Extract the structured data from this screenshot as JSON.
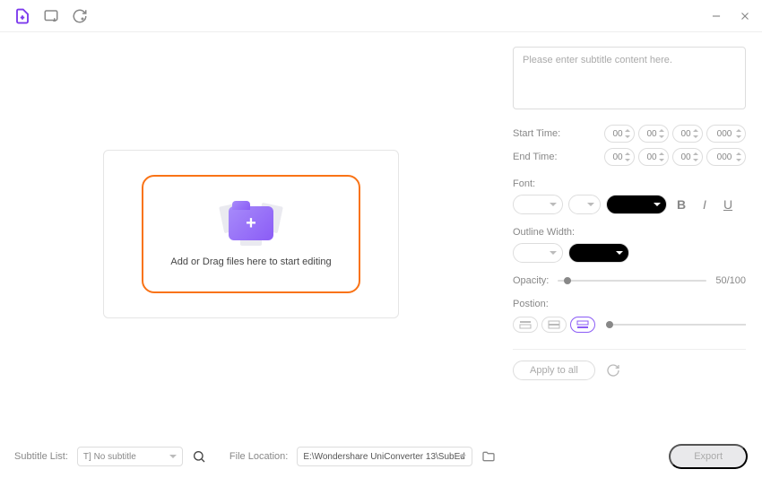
{
  "subtitle": {
    "placeholder": "Please enter subtitle content here.",
    "start_label": "Start Time:",
    "end_label": "End Time:",
    "time_hh": "00",
    "time_mm": "00",
    "time_ss": "00",
    "time_ms": "000"
  },
  "font": {
    "label": "Font:"
  },
  "outline": {
    "label": "Outline Width:"
  },
  "opacity": {
    "label": "Opacity:",
    "value": "50/100"
  },
  "position": {
    "label": "Postion:"
  },
  "apply": {
    "label": "Apply to all"
  },
  "drop": {
    "text": "Add or Drag files here to start editing"
  },
  "footer": {
    "subtitle_list_label": "Subtitle List:",
    "subtitle_select": "T] No subtitle",
    "file_location_label": "File Location:",
    "file_location": "E:\\Wondershare UniConverter 13\\SubEd",
    "export": "Export"
  }
}
